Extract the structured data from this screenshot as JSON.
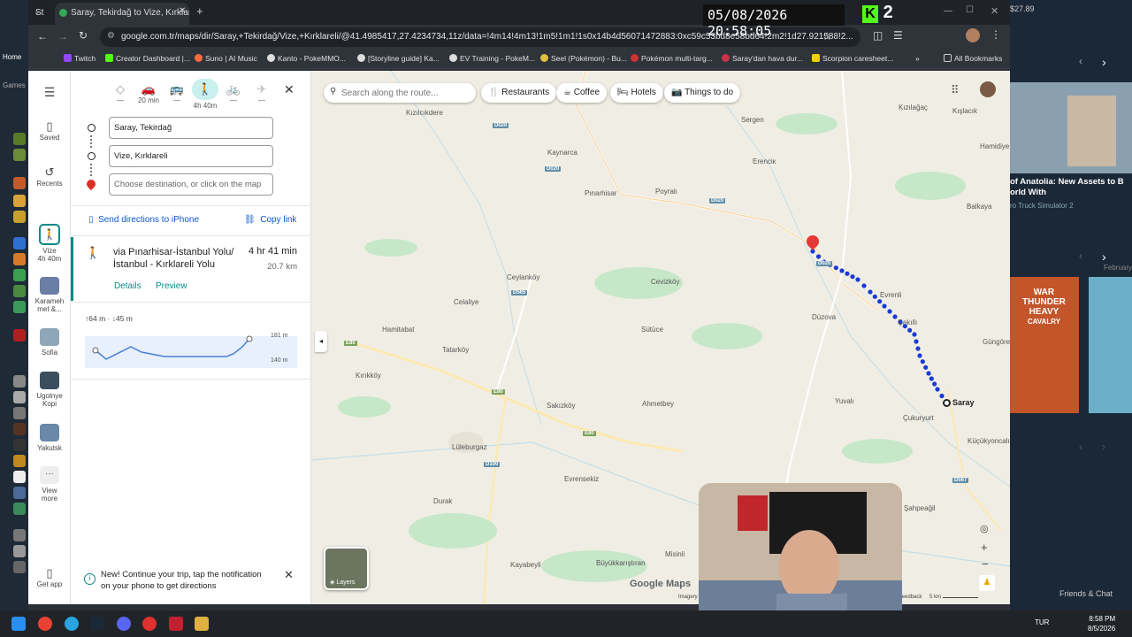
{
  "browser": {
    "tabs": [
      {
        "label": "St"
      },
      {
        "label": "Saray, Tekirdağ to Vize, Kırklareli"
      }
    ],
    "url": "google.com.tr/maps/dir/Saray,+Tekirdağ/Vize,+Kırklareli/@41.4985417,27.4234734,11z/data=!4m14!4m13!1m5!1m1!1s0x14b4d56071472883:0xc59c53bd8e58bd64!2m2!1d27.921588!2...",
    "bookmarks": [
      {
        "label": "Twitch",
        "color": "#9146ff"
      },
      {
        "label": "Creator Dashboard |...",
        "color": "#53fc18"
      },
      {
        "label": "Suno | AI Music",
        "color": "#ff6a3d"
      },
      {
        "label": "Kanto - PokeMMO...",
        "color": "#dddddd"
      },
      {
        "label": "[Storyline guide] Ka...",
        "color": "#dddddd"
      },
      {
        "label": "EV Training - PokeM...",
        "color": "#dddddd"
      },
      {
        "label": "Seel (Pokémon) - Bu...",
        "color": "#e0c040"
      },
      {
        "label": "Pokémon multi-targ...",
        "color": "#cc3333"
      },
      {
        "label": "Saray'dan hava dur...",
        "color": "#cc3344"
      },
      {
        "label": "Scorpion caresheet...",
        "color": "#f0d000"
      }
    ],
    "all_bookmarks": "All Bookmarks",
    "steam_balance": "$27.89"
  },
  "overlay": {
    "datetime": "05/08/2026 20:58:05",
    "k_logo": "K",
    "k_count": "2"
  },
  "rail": {
    "saved": "Saved",
    "recents": "Recents",
    "trip": {
      "line1": "Vize",
      "line2": "4h 40m"
    },
    "places": [
      {
        "label1": "Karameh",
        "label2": "met &...",
        "color": "#6b7ea3"
      },
      {
        "label1": "Sofia",
        "label2": "",
        "color": "#8fa5b8"
      },
      {
        "label1": "Ugolnye",
        "label2": "Kopi",
        "color": "#3a4e5e"
      },
      {
        "label1": "Yakutsk",
        "label2": "",
        "color": "#6a88a8"
      }
    ],
    "view_more1": "View",
    "view_more2": "more",
    "get_app": "Get app"
  },
  "directions": {
    "modes": [
      {
        "name": "best",
        "time": "—"
      },
      {
        "name": "driving",
        "time": "20 min"
      },
      {
        "name": "transit",
        "time": "—"
      },
      {
        "name": "walking",
        "time": "4h 40m"
      },
      {
        "name": "cycling",
        "time": "—"
      },
      {
        "name": "flight",
        "time": "—"
      }
    ],
    "origin": "Saray, Tekirdağ",
    "destination": "Vize, Kırklareli",
    "next_placeholder": "Choose destination, or click on the map",
    "send": "Send directions to iPhone",
    "copy": "Copy link",
    "route": {
      "via1": "via Pınarhisar-İstanbul Yolu/",
      "via2": "İstanbul - Kırklareli Yolu",
      "time": "4 hr 41 min",
      "distance": "20.7 km",
      "details": "Details",
      "preview": "Preview"
    },
    "elevation": {
      "up": "64 m",
      "down": "45 m",
      "max": "181 m",
      "min": "140 m"
    },
    "notice1": "New! Continue your trip, tap the notification",
    "notice2": "on your phone to get directions"
  },
  "map": {
    "search_placeholder": "Search along the route...",
    "chips": [
      "Restaurants",
      "Coffee",
      "Hotels",
      "Things to do"
    ],
    "towns": [
      "Kızılcıkdere",
      "Kaynarca",
      "Pınarhisar",
      "Poyralı",
      "Sergen",
      "Erenciк",
      "Kızılağaç",
      "Kışlacık",
      "Hamidiye",
      "Balkaya",
      "Ceylanköy",
      "Cevizköy",
      "Celaliye",
      "Düzova",
      "Evrenli",
      "Çakıllı",
      "Hamitabat",
      "Sütüce",
      "Tatarköy",
      "Kırıkköy",
      "Güngören",
      "Saray",
      "Yuvalı",
      "Sakızköy",
      "Ahmetbey",
      "Çukuryurt",
      "Küçükyoncalı",
      "Lüleburgaz",
      "Evrensekiz",
      "Durak",
      "Şahpeağil",
      "Kayabeyli",
      "Büyükkarıştıran",
      "Misinli"
    ],
    "roads": [
      "D020",
      "D020",
      "D020",
      "D020",
      "D565",
      "E80",
      "E80",
      "E80",
      "D100",
      "D567"
    ],
    "layers": "Layers",
    "logo": "Google Maps",
    "imagery": "Imagery",
    "scale": "5 km",
    "feedback": "feedback"
  },
  "steam": {
    "news_title1": "of Anatolia: New Assets to B",
    "news_title2": "orld With",
    "news_sub": "ro Truck Simulator 2",
    "month": "February",
    "game_banner1": "WAR",
    "game_banner2": "THUNDER",
    "game_banner3": "HEAVY",
    "game_banner4": "CAVALRY",
    "friends": "Friends & Chat",
    "home": "Home",
    "games": "Games"
  },
  "taskbar": {
    "lang": "TUR",
    "time": "8:58 PM",
    "date": "8/5/2026"
  },
  "route_color": "#1a3bd6",
  "pin_color": "#e53935"
}
